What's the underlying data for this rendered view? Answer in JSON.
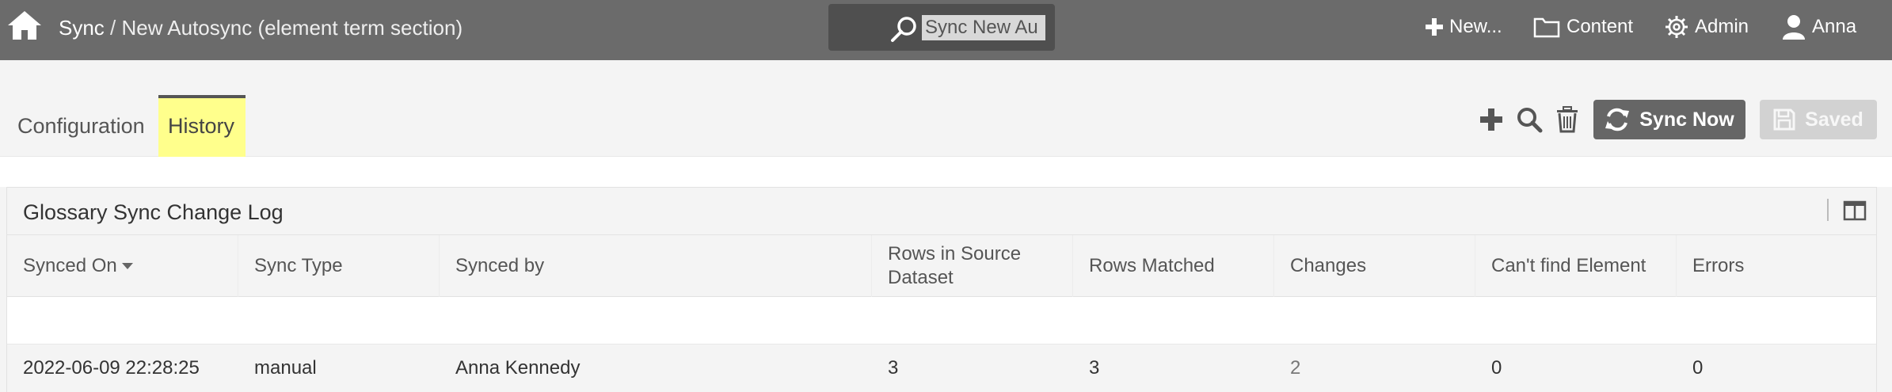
{
  "topbar": {
    "breadcrumb_root": "Sync",
    "breadcrumb_sep": " / ",
    "breadcrumb_current": "New Autosync (element term section)",
    "search_value": "Sync New Au",
    "nav": {
      "new_label": "New...",
      "content_label": "Content",
      "admin_label": "Admin",
      "user_label": "Anna"
    }
  },
  "tabs": {
    "configuration": "Configuration",
    "history": "History"
  },
  "toolbar": {
    "sync_now_label": "Sync Now",
    "saved_label": "Saved"
  },
  "panel": {
    "title": "Glossary Sync Change Log",
    "columns": [
      "Synced On",
      "Sync Type",
      "Synced by",
      "Rows in Source Dataset",
      "Rows Matched",
      "Changes",
      "Can't find Element",
      "Errors"
    ],
    "rows": [
      {
        "synced_on": "2022-06-09 22:28:25",
        "sync_type": "manual",
        "synced_by": "Anna Kennedy",
        "rows_in_source": "3",
        "rows_matched": "3",
        "changes": "2",
        "cant_find": "0",
        "errors": "0"
      }
    ]
  },
  "colors": {
    "topbar": "#6b6b6b",
    "active_tab": "#ffff8c",
    "sync_button": "#666666",
    "saved_button": "#d2d2d2"
  }
}
